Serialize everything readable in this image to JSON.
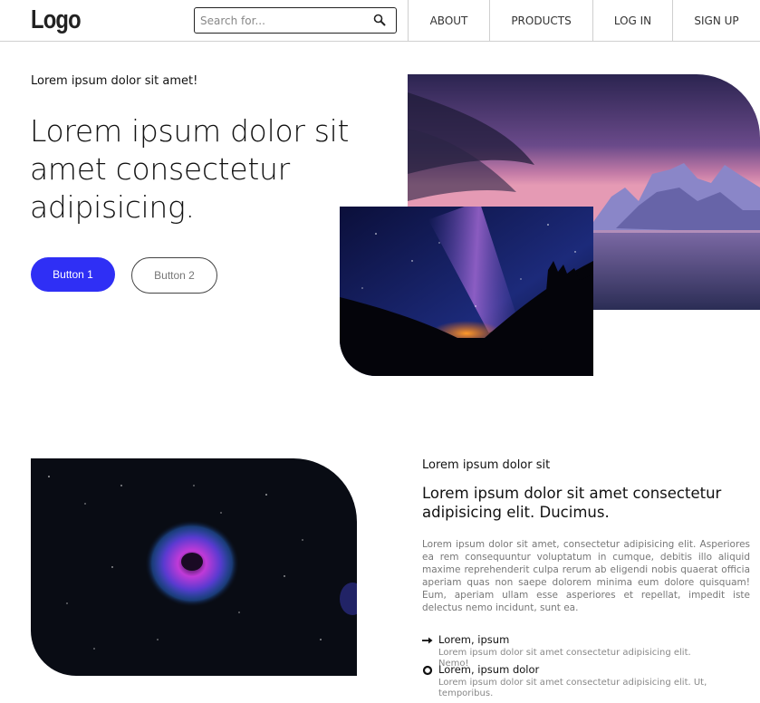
{
  "nav": {
    "logo": "Logo",
    "search_placeholder": "Search for...",
    "links": [
      "ABOUT",
      "PRODUCTS",
      "LOG IN",
      "SIGN UP"
    ]
  },
  "hero": {
    "eyebrow": "Lorem ipsum dolor sit amet!",
    "title": "Lorem ipsum dolor sit amet consectetur adipisicing.",
    "button1": "Button 1",
    "button2": "Button 2"
  },
  "feature": {
    "eyebrow": "Lorem ipsum dolor sit",
    "title": "Lorem ipsum dolor sit amet consectetur adipisicing elit. Ducimus.",
    "body": "Lorem ipsum dolor sit amet, consectetur adipisicing elit. Asperiores ea rem consequuntur voluptatum in cumque, debitis illo aliquid maxime reprehenderit culpa rerum ab eligendi nobis quaerat officia aperiam quas non saepe dolorem minima eum dolore quisquam! Eum, aperiam ullam esse asperiores et repellat, impedit iste delectus nemo incidunt, sunt ea.",
    "items": [
      {
        "label": "Lorem, ipsum",
        "desc": "Lorem ipsum dolor sit amet consectetur adipisicing elit. Nemo!",
        "icon": "arrow-right-icon"
      },
      {
        "label": "Lorem, ipsum dolor",
        "desc": "Lorem ipsum dolor sit amet consectetur adipisicing elit. Ut, temporibus.",
        "icon": "circle-icon"
      }
    ]
  },
  "colors": {
    "primary": "#2f2ff5",
    "text": "#111111",
    "muted": "#777777",
    "border": "#cfcfcf"
  }
}
